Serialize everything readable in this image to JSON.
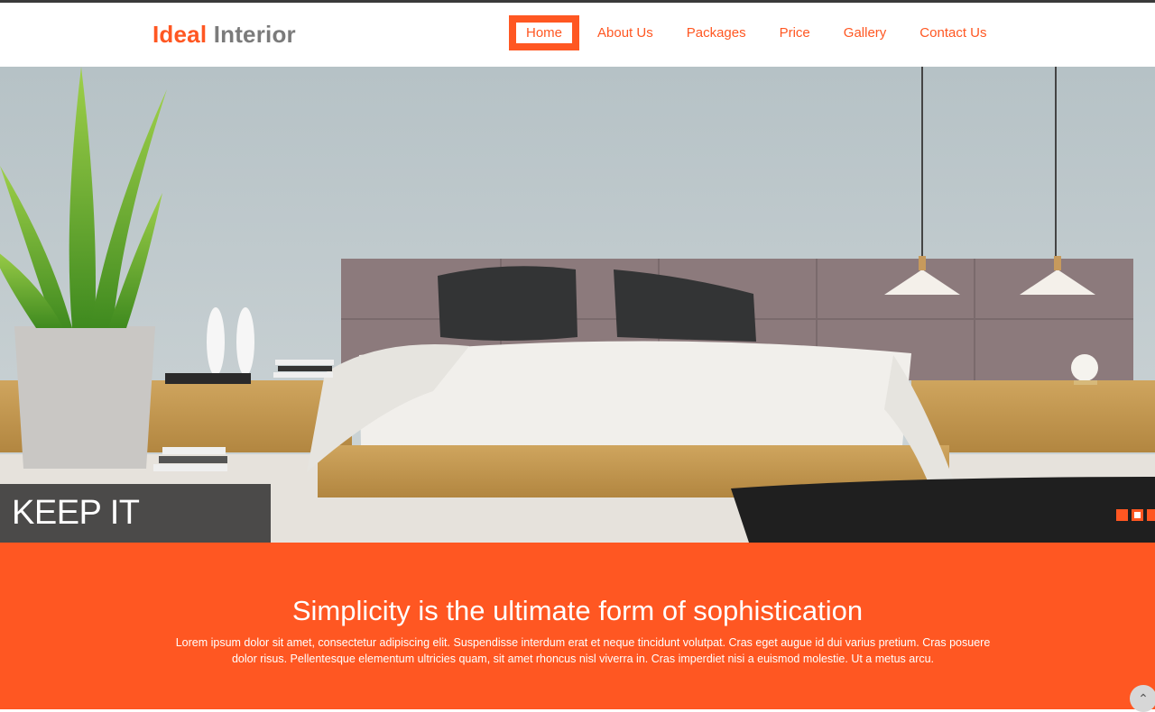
{
  "header": {
    "logo": {
      "part1": "Ideal",
      "part2": "Interior"
    },
    "nav": [
      {
        "label": "Home",
        "active": true
      },
      {
        "label": "About Us"
      },
      {
        "label": "Packages"
      },
      {
        "label": "Price"
      },
      {
        "label": "Gallery"
      },
      {
        "label": "Contact Us"
      }
    ]
  },
  "hero": {
    "caption": "KEEP IT SIMPLE",
    "slides": 3,
    "active_slide": 2
  },
  "section": {
    "title": "Simplicity is the ultimate form of sophistication",
    "body": "Lorem ipsum dolor sit amet, consectetur adipiscing elit. Suspendisse interdum erat et neque tincidunt volutpat. Cras eget augue id dui varius pretium. Cras posuere dolor risus. Pellentesque elementum ultricies quam, sit amet rhoncus nisl viverra in. Cras imperdiet nisi a euismod molestie. Ut a metus arcu."
  },
  "colors": {
    "accent": "#ff5722",
    "logo_secondary": "#7b7b7b",
    "caption_bg": "#282828"
  },
  "icons": {
    "scroll_top": "chevron-up-icon"
  }
}
